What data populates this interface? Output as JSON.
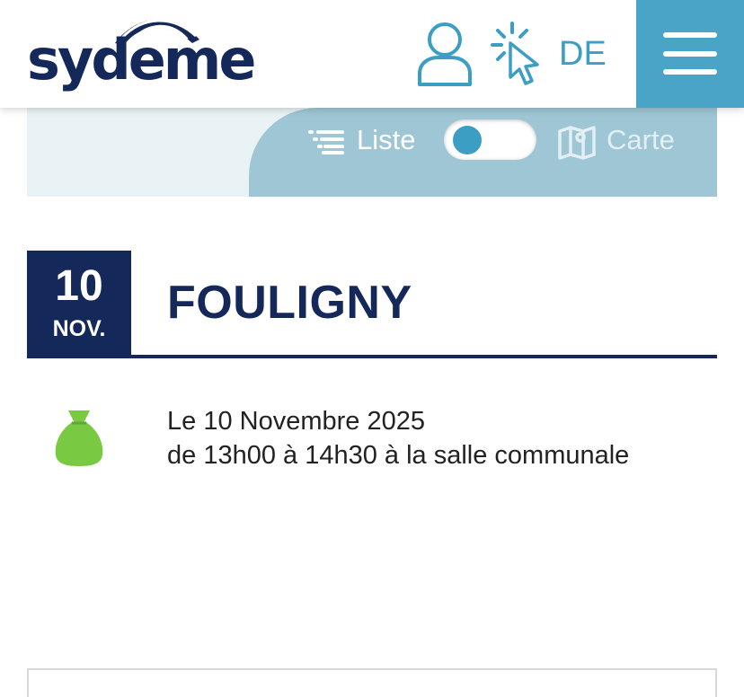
{
  "header": {
    "logo_text": "sydeme",
    "lang_label": "DE",
    "icons": {
      "user": "user-icon",
      "click": "click-cursor-icon",
      "menu": "hamburger-menu-icon"
    }
  },
  "view_toggle": {
    "list_label": "Liste",
    "map_label": "Carte",
    "selected": "Liste"
  },
  "event": {
    "day": "10",
    "month": "NOV.",
    "title": "FOULIGNY",
    "line1": "Le 10 Novembre 2025",
    "line2": "de 13h00 à 14h30 à la salle communale",
    "icon": "green-bag-icon"
  },
  "colors": {
    "brand_navy": "#15285a",
    "accent_blue": "#3d9ec4",
    "menu_blue": "#4aa4c8",
    "toggle_panel": "#9fc6d4",
    "toggle_bg": "#e9f2f5",
    "bag_green": "#7ac943"
  }
}
